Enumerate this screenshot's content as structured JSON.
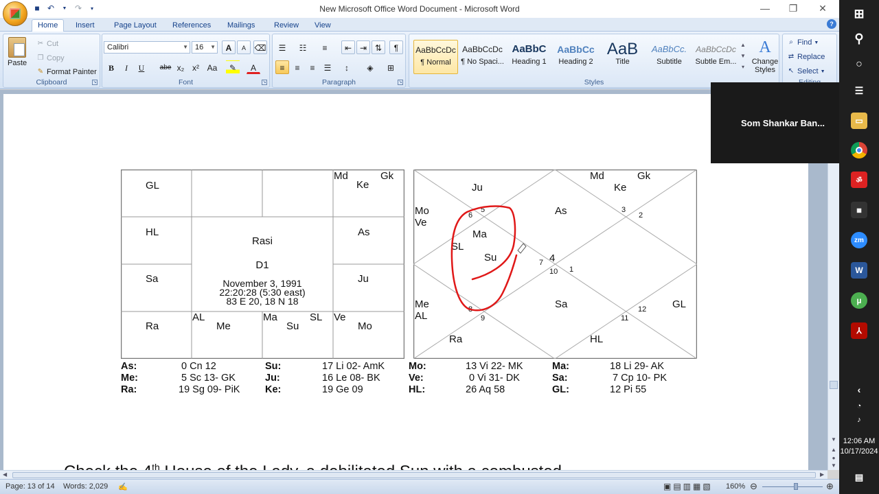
{
  "window": {
    "title": "New Microsoft Office Word Document - Microsoft Word",
    "min": "—",
    "restore": "❐",
    "close": "✕"
  },
  "tabs": [
    "Home",
    "Insert",
    "Page Layout",
    "References",
    "Mailings",
    "Review",
    "View"
  ],
  "ribbon": {
    "clipboard": {
      "label": "Clipboard",
      "paste": "Paste",
      "cut": "Cut",
      "copy": "Copy",
      "format_painter": "Format Painter"
    },
    "font": {
      "label": "Font",
      "font_name": "Calibri",
      "font_size": "16",
      "bold": "B",
      "italic": "I",
      "underline": "U",
      "strike": "abe",
      "subscript": "x₂",
      "superscript": "x²",
      "change_case": "Aa",
      "grow": "A",
      "shrink": "A"
    },
    "paragraph": {
      "label": "Paragraph"
    },
    "styles": {
      "label": "Styles",
      "items": [
        {
          "sample": "AaBbCcDc",
          "name": "¶ Normal"
        },
        {
          "sample": "AaBbCcDc",
          "name": "¶ No Spaci..."
        },
        {
          "sample": "AaBbC",
          "name": "Heading 1"
        },
        {
          "sample": "AaBbCc",
          "name": "Heading 2"
        },
        {
          "sample": "AaB",
          "name": "Title"
        },
        {
          "sample": "AaBbCc.",
          "name": "Subtitle"
        },
        {
          "sample": "AaBbCcDc",
          "name": "Subtle Em..."
        }
      ],
      "change_styles": "Change Styles"
    },
    "editing": {
      "label": "Editing",
      "find": "Find",
      "replace": "Replace",
      "select": "Select"
    }
  },
  "rasi_chart": {
    "cells": {
      "top_left": "GL",
      "top_right_a": "Md",
      "top_right_b": "Gk",
      "top_right_c": "Ke",
      "left_2": "HL",
      "right_2": "As",
      "left_3": "Sa",
      "right_3": "Ju",
      "bottom_left": "Ra",
      "bottom_2a": "AL",
      "bottom_2b": "Me",
      "bottom_3a": "Ma",
      "bottom_3b": "SL",
      "bottom_3c": "Su",
      "bottom_right_a": "Ve",
      "bottom_right_b": "Mo"
    },
    "center_title": "Rasi",
    "center_sub": "D1",
    "date": "November 3, 1991",
    "time": "22:20:28 (5:30 east)",
    "coords": "83 E 20, 18 N 18"
  },
  "north_chart": {
    "labels": {
      "ju": "Ju",
      "md": "Md",
      "gk": "Gk",
      "ke": "Ke",
      "mo": "Mo",
      "ve": "Ve",
      "as": "As",
      "ma": "Ma",
      "sl": "SL",
      "su": "Su",
      "me": "Me",
      "al": "AL",
      "sa": "Sa",
      "gl": "GL",
      "ra": "Ra",
      "hl": "HL"
    },
    "houses": {
      "h1": "1",
      "h2": "2",
      "h3": "3",
      "h4": "4",
      "h5": "5",
      "h6": "6",
      "h7": "7",
      "h8": "8",
      "h9": "9",
      "h10": "10",
      "h11": "11",
      "h12": "12"
    }
  },
  "positions": [
    [
      "As:",
      "0 Cn 12",
      "Su:",
      "17 Li 02- AmK",
      "Mo:",
      "13 Vi 22- MK",
      "Ma:",
      "18 Li 29- AK"
    ],
    [
      "Me:",
      "5 Sc 13- GK",
      "Ju:",
      "16 Le 08- BK",
      "Ve:",
      "0 Vi 31- DK",
      "Sa:",
      "7 Cp 10- PK"
    ],
    [
      "Ra:",
      "19 Sg 09- PiK",
      "Ke:",
      "19 Ge 09",
      "HL:",
      "26 Aq 58",
      "GL:",
      "12 Pi 55"
    ]
  ],
  "partial_line": {
    "before": "Check the 4",
    "sup": "th",
    "after": " House of the Lady, a debilitated Sun with a combusted"
  },
  "overlay_name": "Som Shankar Ban...",
  "status": {
    "page": "Page: 13 of 14",
    "words": "Words: 2,029",
    "zoom": "160%"
  },
  "clock": {
    "time": "12:06 AM",
    "date": "10/17/2024"
  }
}
